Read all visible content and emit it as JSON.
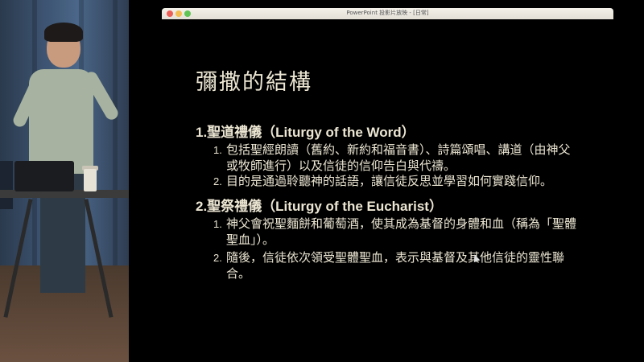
{
  "window": {
    "title": "PowerPoint 投影片放映 - [日常]"
  },
  "slide": {
    "title": "彌撒的結構",
    "sections": [
      {
        "heading": "1.聖道禮儀（Liturgy of the Word）",
        "items": [
          {
            "number": "1.",
            "text": "包括聖經朗讀（舊約、新約和福音書）、詩篇頌唱、講道（由神父或牧師進行）以及信徒的信仰告白與代禱。"
          },
          {
            "number": "2.",
            "text": "目的是通過聆聽神的話語，讓信徒反思並學習如何實踐信仰。"
          }
        ]
      },
      {
        "heading": "2.聖祭禮儀（Liturgy of the Eucharist）",
        "items": [
          {
            "number": "1.",
            "text": "神父會祝聖麵餅和葡萄酒，使其成為基督的身體和血（稱為「聖體聖血」）。"
          },
          {
            "number": "2.",
            "text": "隨後，信徒依次領受聖體聖血，表示與基督及其他信徒的靈性聯合。"
          }
        ]
      }
    ]
  }
}
